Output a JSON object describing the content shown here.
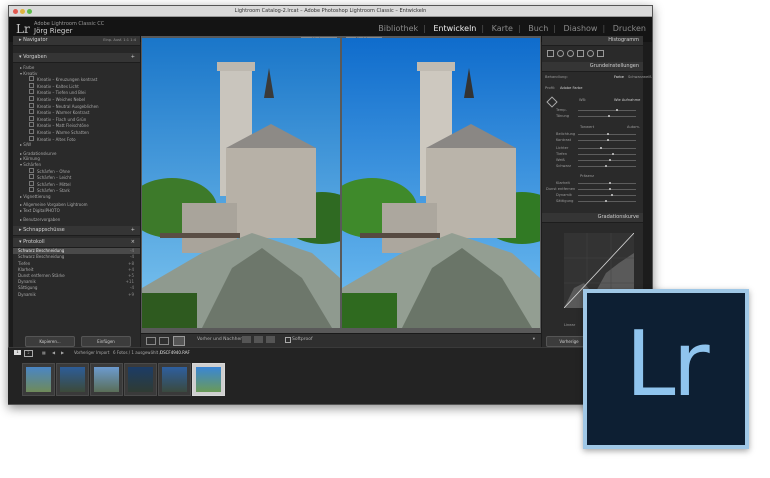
{
  "window": {
    "title": "Lightroom Catalog-2.lrcat – Adobe Photoshop Lightroom Classic – Entwickeln"
  },
  "identity": {
    "logo": "Lr",
    "line1": "Adobe Lightroom Classic CC",
    "name": "Jörg Rieger"
  },
  "modules": [
    "Bibliothek",
    "Entwickeln",
    "Karte",
    "Buch",
    "Diashow",
    "Drucken"
  ],
  "active_module": "Entwickeln",
  "left_panel": {
    "navigator": {
      "label": "Navigator",
      "zoom": [
        "Einp.",
        "Ausf.",
        "1:1",
        "1:4"
      ]
    },
    "presets": {
      "label": "Vorgaben",
      "groups_top": [
        "Farbe",
        "Kreativ"
      ],
      "kreativ_items": [
        "Kreativ – Kreuzungen kontrast",
        "Kreativ – Kaltes Licht",
        "Kreativ – Tiefen und Blei",
        "Kreativ – Weiches Nebel",
        "Kreativ – Neutral Ausgeblichen",
        "Kreativ – Warmer Kontrast",
        "Kreativ – Flach und Grün",
        "Kreativ – Matt Fleischtöne",
        "Kreativ – Warme Schatten",
        "Kreativ – Altes Foto"
      ],
      "groups_mid": [
        "S/W",
        "Gradationskurve",
        "Körnung",
        "Schärfen"
      ],
      "schaerfen_items": [
        "Schärfen – Ohne",
        "Schärfen – Leicht",
        "Schärfen – Mittel",
        "Schärfen – Stark"
      ],
      "groups_bottom": [
        "Vignettierung",
        "Allgemeine Vorgaben Lightroom",
        "Text DigitalPHOTO",
        "Benutzervorgaben"
      ]
    },
    "snapshots": {
      "label": "Schnappschüsse"
    },
    "history": {
      "label": "Protokoll",
      "rows": [
        {
          "label": "Schwarz Beschneidung",
          "value": "-4",
          "value2": "0"
        },
        {
          "label": "Schwarz Beschneidung",
          "value": "-4",
          "value2": "-4"
        },
        {
          "label": "Tiefen",
          "value": "+8",
          "value2": "0"
        },
        {
          "label": "Klarheit",
          "value": "+4",
          "value2": "4"
        },
        {
          "label": "Dunst entfernen Stärke",
          "value": "+5",
          "value2": "5"
        },
        {
          "label": "Dynamik",
          "value": "+11",
          "value2": "21"
        },
        {
          "label": "Sättigung",
          "value": "-4",
          "value2": "-4"
        },
        {
          "label": "Dynamik",
          "value": "+9",
          "value2": "10"
        }
      ]
    },
    "buttons": {
      "copy": "Kopieren...",
      "paste": "Einfügen"
    }
  },
  "center": {
    "before_label": "Vorher",
    "after_label": "Nachher"
  },
  "toolbar": {
    "compare_label": "Vorher und Nachher:",
    "softproof": "Softproof"
  },
  "right_panel": {
    "histogram_label": "Histogramm",
    "basic_label": "Grundeinstellungen",
    "treatment": {
      "label": "Behandlung:",
      "color": "Farbe",
      "bw": "Schwarzweiß"
    },
    "profile": {
      "label": "Profil:",
      "value": "Adobe Farbe"
    },
    "wb": {
      "label": "WB:",
      "value": "Wie Aufnahme"
    },
    "sliders_wb": [
      "Temp.",
      "Tönung"
    ],
    "tone_label": "Tonwert",
    "tone_auto": "Autom.",
    "sliders_tone": [
      "Belichtung",
      "Kontrast",
      "Lichter",
      "Tiefen",
      "Weiß",
      "Schwarz"
    ],
    "presence_label": "Präsenz",
    "sliders_presence": [
      "Klarheit",
      "Dunst entfernen",
      "Dynamik",
      "Sättigung"
    ],
    "curve_label": "Gradationskurve",
    "curve_mode": "Linear",
    "buttons": {
      "prev": "Vorherige",
      "reset": "Zurücksetzen"
    }
  },
  "filmstrip": {
    "pages": [
      "1",
      "2"
    ],
    "source": "Vorheriger Import",
    "count": "6 Fotos / 1 ausgewählt /",
    "filename": "DSCF4940.RAF"
  },
  "colors": {
    "app_bg": "#1c1c1c",
    "panel_bg": "#2a2a2a",
    "logo_bg": "#0d1f33",
    "logo_fg": "#8fc4ee"
  }
}
